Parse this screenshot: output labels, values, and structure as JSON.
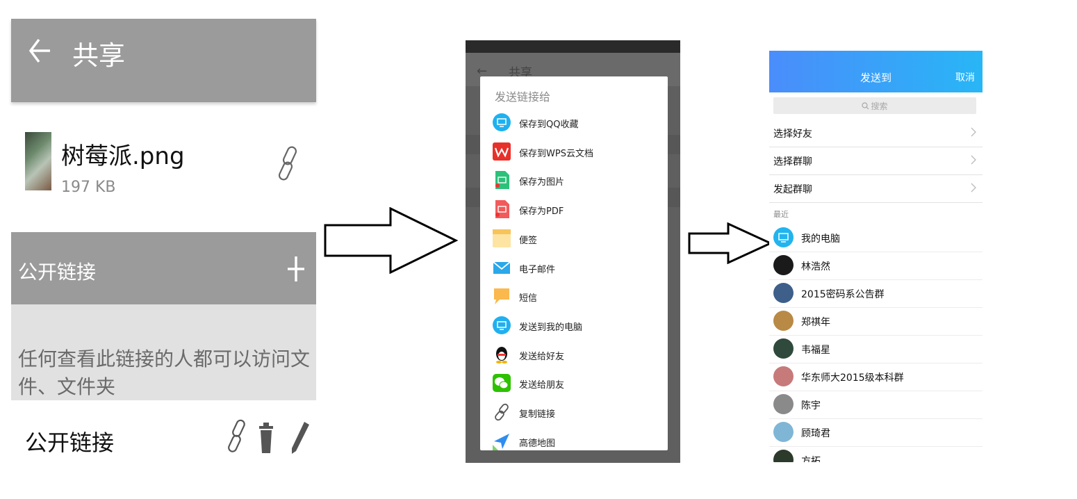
{
  "panel1": {
    "title": "共享",
    "file_name": "树莓派.png",
    "file_size": "197 KB",
    "section_title": "公开链接",
    "info_text": "任何查看此链接的人都可以访问文件、文件夹",
    "public_link_label": "公开链接",
    "icons": [
      "back-arrow-icon",
      "link-icon",
      "plus-icon",
      "link-icon",
      "trash-icon",
      "pencil-icon"
    ]
  },
  "panel2": {
    "bg_title": "共享",
    "dialog_title": "发送链接给",
    "items": [
      {
        "label": "保存到QQ收藏",
        "icon": "qq-favorites-icon",
        "color": "#1fb1ef"
      },
      {
        "label": "保存到WPS云文档",
        "icon": "wps-icon",
        "color": "#e8302a"
      },
      {
        "label": "保存为图片",
        "icon": "image-icon",
        "color": "#2bc17a"
      },
      {
        "label": "保存为PDF",
        "icon": "pdf-icon",
        "color": "#f15b5b"
      },
      {
        "label": "便签",
        "icon": "note-icon",
        "color": "#f7c45a"
      },
      {
        "label": "电子邮件",
        "icon": "mail-icon",
        "color": "#2aa8ea"
      },
      {
        "label": "短信",
        "icon": "sms-icon",
        "color": "#fbb84c"
      },
      {
        "label": "发送到我的电脑",
        "icon": "computer-icon",
        "color": "#20b0f0"
      },
      {
        "label": "发送给好友",
        "icon": "qq-penguin-icon",
        "color": "#111111"
      },
      {
        "label": "发送给朋友",
        "icon": "wechat-icon",
        "color": "#2dc100"
      },
      {
        "label": "复制链接",
        "icon": "link-icon",
        "color": "#555555"
      },
      {
        "label": "高德地图",
        "icon": "amap-icon",
        "color": "#2f8df0"
      }
    ]
  },
  "panel3": {
    "title": "发送到",
    "cancel": "取消",
    "search_placeholder": "搜索",
    "menu": [
      {
        "label": "选择好友"
      },
      {
        "label": "选择群聊"
      },
      {
        "label": "发起群聊"
      }
    ],
    "recent_label": "最近",
    "contacts": [
      {
        "name": "我的电脑",
        "color": "#21b4ef"
      },
      {
        "name": "林浩然",
        "color": "#1a1a1a"
      },
      {
        "name": "2015密码系公告群",
        "color": "#3d5f8a"
      },
      {
        "name": "郑祺年",
        "color": "#b88a46"
      },
      {
        "name": "韦福星",
        "color": "#2f4a3c"
      },
      {
        "name": "华东师大2015级本科群",
        "color": "#c77a7a"
      },
      {
        "name": "陈宇",
        "color": "#8a8a8a"
      },
      {
        "name": "顾琦君",
        "color": "#7fb6d6"
      },
      {
        "name": "方拓",
        "color": "#2b3a2b"
      }
    ]
  }
}
